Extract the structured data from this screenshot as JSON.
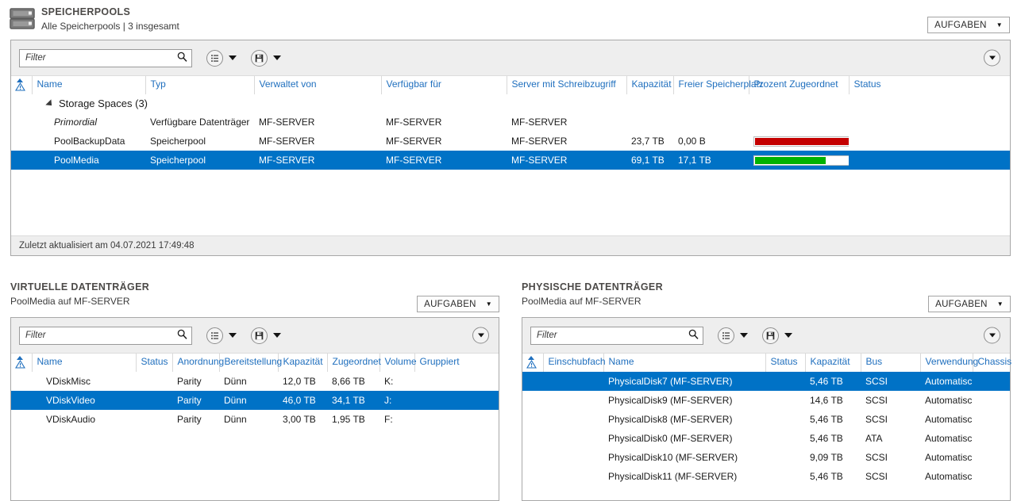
{
  "header": {
    "icon": "storage-pool-icon",
    "title": "SPEICHERPOOLS",
    "subtitle": "Alle Speicherpools | 3 insgesamt",
    "tasks_label": "AUFGABEN"
  },
  "toolbar": {
    "filter_placeholder": "Filter",
    "filter_value": "",
    "search_icon": "search-icon",
    "list_view_icon": "list-view-icon",
    "save_view_icon": "save-view-icon",
    "caret_icon": "caret-down-icon",
    "expander_icon": "chevron-down-icon"
  },
  "pools": {
    "columns": [
      "Name",
      "Typ",
      "Verwaltet von",
      "Verfügbar für",
      "Server mit Schreibzugriff",
      "Kapazität",
      "Freier Speicherplatz",
      "Prozent Zugeordnet",
      "Status"
    ],
    "group": {
      "label": "Storage Spaces (3)",
      "count": 3,
      "expanded": true
    },
    "rows": [
      {
        "name": "Primordial",
        "typ": "Verfügbare Datenträger",
        "verwaltet_von": "MF-SERVER",
        "verfuegbar_fuer": "MF-SERVER",
        "server_schreibzugriff": "MF-SERVER",
        "kapazitaet": "",
        "freier_speicherplatz": "",
        "prozent_zugeordnet": null,
        "bar_color": "",
        "status": "",
        "selected": false,
        "italic": true
      },
      {
        "name": "PoolBackupData",
        "typ": "Speicherpool",
        "verwaltet_von": "MF-SERVER",
        "verfuegbar_fuer": "MF-SERVER",
        "server_schreibzugriff": "MF-SERVER",
        "kapazitaet": "23,7 TB",
        "freier_speicherplatz": "0,00 B",
        "prozent_zugeordnet": 100,
        "bar_color": "#c40000",
        "status": "",
        "selected": false,
        "italic": false
      },
      {
        "name": "PoolMedia",
        "typ": "Speicherpool",
        "verwaltet_von": "MF-SERVER",
        "verfuegbar_fuer": "MF-SERVER",
        "server_schreibzugriff": "MF-SERVER",
        "kapazitaet": "69,1 TB",
        "freier_speicherplatz": "17,1 TB",
        "prozent_zugeordnet": 75,
        "bar_color": "#00b200",
        "status": "",
        "selected": true,
        "italic": false
      }
    ],
    "refresh_text": "Zuletzt aktualisiert am 04.07.2021 17:49:48"
  },
  "virtual_disks": {
    "title": "VIRTUELLE DATENTRÄGER",
    "subtitle": "PoolMedia auf MF-SERVER",
    "tasks_label": "AUFGABEN",
    "filter_placeholder": "Filter",
    "columns": [
      "Name",
      "Status",
      "Anordnung",
      "Bereitstellung",
      "Kapazität",
      "Zugeordnet",
      "Volume",
      "Gruppiert"
    ],
    "rows": [
      {
        "name": "VDiskMisc",
        "status": "",
        "anordnung": "Parity",
        "bereitstellung": "Dünn",
        "kapazitaet": "12,0 TB",
        "zugeordnet": "8,66 TB",
        "volume": "K:",
        "gruppiert": "",
        "selected": false
      },
      {
        "name": "VDiskVideo",
        "status": "",
        "anordnung": "Parity",
        "bereitstellung": "Dünn",
        "kapazitaet": "46,0 TB",
        "zugeordnet": "34,1 TB",
        "volume": "J:",
        "gruppiert": "",
        "selected": true
      },
      {
        "name": "VDiskAudio",
        "status": "",
        "anordnung": "Parity",
        "bereitstellung": "Dünn",
        "kapazitaet": "3,00 TB",
        "zugeordnet": "1,95 TB",
        "volume": "F:",
        "gruppiert": "",
        "selected": false
      }
    ]
  },
  "physical_disks": {
    "title": "PHYSISCHE DATENTRÄGER",
    "subtitle": "PoolMedia auf MF-SERVER",
    "tasks_label": "AUFGABEN",
    "filter_placeholder": "Filter",
    "columns": [
      "Einschubfach",
      "Name",
      "Status",
      "Kapazität",
      "Bus",
      "Verwendung",
      "Chassis"
    ],
    "rows": [
      {
        "einschubfach": "",
        "name": "PhysicalDisk7 (MF-SERVER)",
        "status": "",
        "kapazitaet": "5,46 TB",
        "bus": "SCSI",
        "verwendung": "Automatisch",
        "chassis": "",
        "selected": true
      },
      {
        "einschubfach": "",
        "name": "PhysicalDisk9 (MF-SERVER)",
        "status": "",
        "kapazitaet": "14,6 TB",
        "bus": "SCSI",
        "verwendung": "Automatisch",
        "chassis": "",
        "selected": false
      },
      {
        "einschubfach": "",
        "name": "PhysicalDisk8 (MF-SERVER)",
        "status": "",
        "kapazitaet": "5,46 TB",
        "bus": "SCSI",
        "verwendung": "Automatisch",
        "chassis": "",
        "selected": false
      },
      {
        "einschubfach": "",
        "name": "PhysicalDisk0 (MF-SERVER)",
        "status": "",
        "kapazitaet": "5,46 TB",
        "bus": "ATA",
        "verwendung": "Automatisch",
        "chassis": "",
        "selected": false
      },
      {
        "einschubfach": "",
        "name": "PhysicalDisk10 (MF-SERVER)",
        "status": "",
        "kapazitaet": "9,09 TB",
        "bus": "SCSI",
        "verwendung": "Automatisch",
        "chassis": "",
        "selected": false
      },
      {
        "einschubfach": "",
        "name": "PhysicalDisk11 (MF-SERVER)",
        "status": "",
        "kapazitaet": "5,46 TB",
        "bus": "SCSI",
        "verwendung": "Automatisch",
        "chassis": "",
        "selected": false
      }
    ]
  },
  "colors": {
    "selection": "#0072c6",
    "header_link": "#1f6fbe",
    "bar_full": "#c40000",
    "bar_ok": "#00b200",
    "toolbar_bg": "#eeeeee"
  }
}
